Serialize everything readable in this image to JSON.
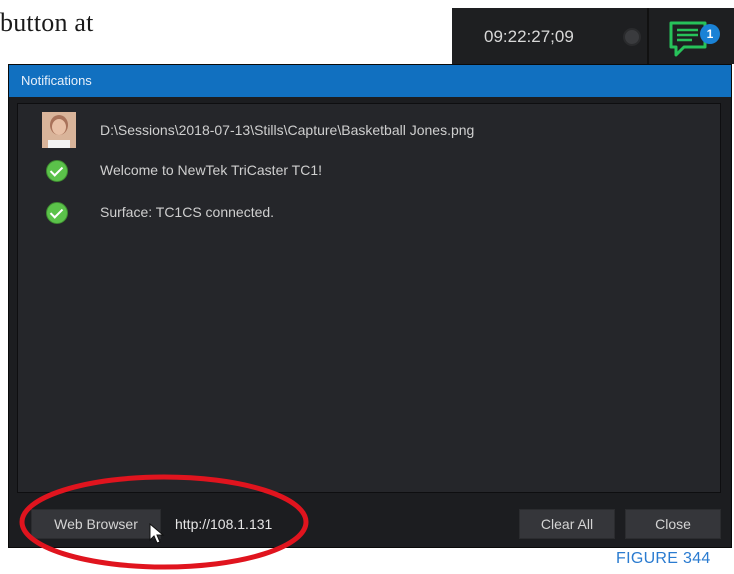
{
  "doc": {
    "text": "button at"
  },
  "topbar": {
    "timecode": "09:22:27;09",
    "notification_badge": "1"
  },
  "window": {
    "title": "Notifications",
    "notifications": [
      {
        "icon": "user-thumbnail",
        "text": "D:\\Sessions\\2018-07-13\\Stills\\Capture\\Basketball Jones.png"
      },
      {
        "icon": "check-circle-icon",
        "text": "Welcome to NewTek TriCaster TC1!"
      },
      {
        "icon": "check-circle-icon",
        "text": "Surface: TC1CS connected."
      }
    ],
    "footer": {
      "web_browser_label": "Web Browser",
      "url": "http://108.1.131",
      "clear_all_label": "Clear All",
      "close_label": "Close"
    }
  },
  "figure_label": "FIGURE 344",
  "colors": {
    "titlebar": "#1170c0",
    "success": "#5bc24a",
    "badge": "#1a82d6",
    "annotation": "#e0141e",
    "figure_label": "#2a7bd0",
    "notif_icon": "#27c25a"
  }
}
